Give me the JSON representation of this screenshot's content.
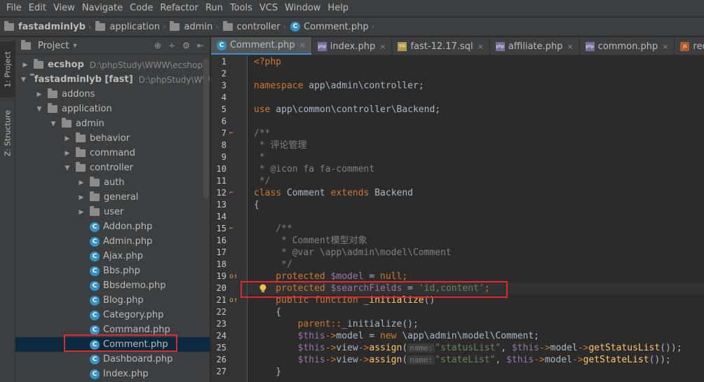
{
  "menu": [
    "File",
    "Edit",
    "View",
    "Navigate",
    "Code",
    "Refactor",
    "Run",
    "Tools",
    "VCS",
    "Window",
    "Help"
  ],
  "breadcrumb": [
    "fastadminlyb",
    "application",
    "admin",
    "controller",
    "Comment.php"
  ],
  "side_tabs": {
    "project": "1: Project",
    "structure": "Z: Structure"
  },
  "panel": {
    "title": "Project",
    "tools": [
      "⊕",
      "÷",
      "⚙",
      "⇤"
    ]
  },
  "tree": [
    {
      "label": "ecshop",
      "path": "D:\\phpStudy\\WWW\\ecshop",
      "type": "folder",
      "depth": 0,
      "expanded": false,
      "bold": true
    },
    {
      "label": "fastadminlyb [fast]",
      "path": "D:\\phpStudy\\WWW\\fastadminlyb",
      "type": "folder",
      "depth": 0,
      "expanded": true,
      "bold": true
    },
    {
      "label": "addons",
      "path": "",
      "type": "folder",
      "depth": 1,
      "expanded": false
    },
    {
      "label": "application",
      "path": "",
      "type": "folder",
      "depth": 1,
      "expanded": true
    },
    {
      "label": "admin",
      "path": "",
      "type": "folder",
      "depth": 2,
      "expanded": true
    },
    {
      "label": "behavior",
      "path": "",
      "type": "folder",
      "depth": 3,
      "expanded": false
    },
    {
      "label": "command",
      "path": "",
      "type": "folder",
      "depth": 3,
      "expanded": false
    },
    {
      "label": "controller",
      "path": "",
      "type": "folder",
      "depth": 3,
      "expanded": true
    },
    {
      "label": "auth",
      "path": "",
      "type": "folder",
      "depth": 4,
      "expanded": false
    },
    {
      "label": "general",
      "path": "",
      "type": "folder",
      "depth": 4,
      "expanded": false
    },
    {
      "label": "user",
      "path": "",
      "type": "folder",
      "depth": 4,
      "expanded": false
    },
    {
      "label": "Addon.php",
      "path": "",
      "type": "file",
      "depth": 4
    },
    {
      "label": "Admin.php",
      "path": "",
      "type": "file",
      "depth": 4
    },
    {
      "label": "Ajax.php",
      "path": "",
      "type": "file",
      "depth": 4
    },
    {
      "label": "Bbs.php",
      "path": "",
      "type": "file",
      "depth": 4
    },
    {
      "label": "Bbsdemo.php",
      "path": "",
      "type": "file",
      "depth": 4
    },
    {
      "label": "Blog.php",
      "path": "",
      "type": "file",
      "depth": 4
    },
    {
      "label": "Category.php",
      "path": "",
      "type": "file",
      "depth": 4
    },
    {
      "label": "Command.php",
      "path": "",
      "type": "file",
      "depth": 4
    },
    {
      "label": "Comment.php",
      "path": "",
      "type": "file",
      "depth": 4,
      "selected": true
    },
    {
      "label": "Dashboard.php",
      "path": "",
      "type": "file",
      "depth": 4
    },
    {
      "label": "Index.php",
      "path": "",
      "type": "file",
      "depth": 4
    }
  ],
  "tabs": [
    {
      "label": "Comment.php",
      "icon": "class-icon",
      "active": true
    },
    {
      "label": "index.php",
      "icon": "php-icon"
    },
    {
      "label": "fast-12.17.sql",
      "icon": "sql-icon"
    },
    {
      "label": "affiliate.php",
      "icon": "php-icon"
    },
    {
      "label": "common.php",
      "icon": "php-icon"
    },
    {
      "label": "require-tab",
      "icon": "js-icon"
    }
  ],
  "line_numbers": [
    "1",
    "2",
    "3",
    "4",
    "5",
    "6",
    "7",
    "8",
    "9",
    "10",
    "11",
    "12",
    "13",
    "14",
    "15",
    "16",
    "17",
    "18",
    "19",
    "20",
    "21",
    "22",
    "23",
    "24",
    "25",
    "26",
    "27"
  ],
  "code": {
    "l1": "<?php",
    "l3_kw": "namespace",
    "l3_rest": " app\\admin\\controller;",
    "l5_kw": "use",
    "l5_rest": " app\\common\\controller\\Backend;",
    "l7": "/**",
    "l8": " * 评论管理",
    "l9": " *",
    "l10": " * @icon fa fa-comment",
    "l11": " */",
    "l12_kw1": "class",
    "l12_name": " Comment ",
    "l12_kw2": "extends",
    "l12_base": " Backend",
    "l13": "{",
    "l15": "    /**",
    "l16": "     * Comment模型对象",
    "l17": "     * @var \\app\\admin\\model\\Comment",
    "l18": "     */",
    "l19_kw": "    protected",
    "l19_var": " $model",
    "l19_rest": " = ",
    "l19_val": "null",
    "l19_end": ";",
    "l20_kw": "    protected",
    "l20_var": " $searchFields",
    "l20_eq": " = ",
    "l20_str": "'id,content'",
    "l20_end": ";",
    "l21_kw": "    public function",
    "l21_fn": " _initialize",
    "l21_rest": "()",
    "l22": "    {",
    "l23_a": "        parent::",
    "l23_b": "_initialize",
    "l23_c": "();",
    "l24_a": "        $this",
    "l24_b": "->",
    "l24_c": "model",
    "l24_d": " = ",
    "l24_e": "new",
    "l24_f": " \\app\\admin\\model\\Comment;",
    "l25_a": "        $this",
    "l25_b": "->",
    "l25_c": "view",
    "l25_d": "->",
    "l25_e": "assign",
    "l25_f": "(",
    "l25_hint": "name:",
    "l25_g": "\"statusList\"",
    "l25_h": ", ",
    "l25_i": "$this",
    "l25_j": "->",
    "l25_k": "model",
    "l25_l": "->",
    "l25_m": "getStatusList",
    "l25_n": "());",
    "l26_a": "        $this",
    "l26_b": "->",
    "l26_c": "view",
    "l26_d": "->",
    "l26_e": "assign",
    "l26_f": "(",
    "l26_hint": "name:",
    "l26_g": "\"stateList\"",
    "l26_h": ", ",
    "l26_i": "$this",
    "l26_j": "->",
    "l26_k": "model",
    "l26_l": "->",
    "l26_m": "getStateList",
    "l26_n": "());",
    "l27": "    }"
  },
  "colors": {
    "keyword": "#cc7832",
    "string": "#6a8759",
    "variable": "#9876aa",
    "comment": "#808080",
    "function": "#ffc66d",
    "highlight_box": "#e3282b",
    "selection": "#0d293e"
  }
}
